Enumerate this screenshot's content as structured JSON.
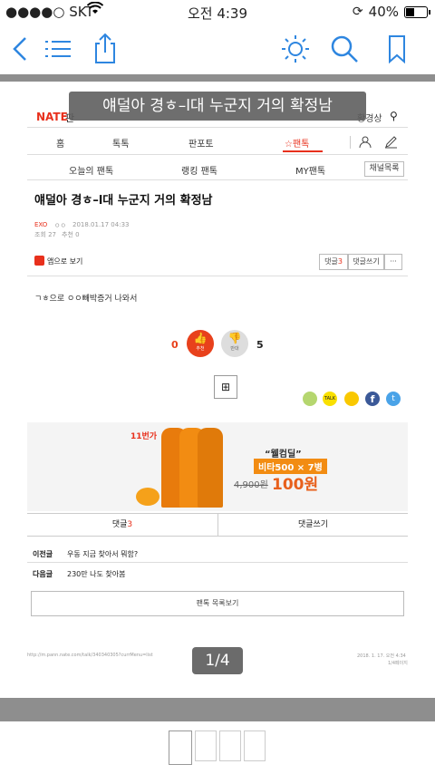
{
  "status_bar": {
    "carrier": "●●●●○ SKT",
    "time": "오전 4:39",
    "battery": "40%"
  },
  "toolbar": {
    "icons": [
      "back-icon",
      "list-icon",
      "share-icon",
      "brightness-icon",
      "search-icon",
      "bookmark-icon"
    ]
  },
  "overlay_title": "얘덜아 경ㅎ–l대 누군지 거의 확정남",
  "site": {
    "logo": "NATE",
    "sub": "판",
    "user": "황경상"
  },
  "nav": {
    "main": [
      "홈",
      "톡톡",
      "판포토",
      "☆팬톡"
    ],
    "sub": [
      "오늘의 팬톡",
      "랭킹 팬톡",
      "MY팬톡"
    ],
    "channel_btn": "채널목록"
  },
  "article": {
    "title": "얘덜아 경ㅎ–l대 누군지 거의 확정남",
    "category": "EXO",
    "author": "ㅇㅇ",
    "date": "2018.01.17 04:33",
    "views": "조회 27",
    "recommend": "추천 0",
    "app_view": "앱으로 보기",
    "comment_btn": "댓글",
    "comment_count": "3",
    "write_btn": "댓글쓰기",
    "more_btn": "···",
    "body": "ㄱㅎ으로 ㅇㅇ빼박증거 나와서"
  },
  "votes": {
    "up": "0",
    "up_label": "추천",
    "down": "5",
    "down_label": "반대"
  },
  "ad": {
    "badge": "11번가",
    "tag": "“웰컴딜”",
    "product": "비타500 × 7병",
    "old_price": "4,900원",
    "price": "100원"
  },
  "tabs": {
    "comments": "댓글",
    "comments_count": "3",
    "write": "댓글쓰기"
  },
  "prev": {
    "label": "이전글",
    "text": "우동 지금 찾아서 뭐함?"
  },
  "next": {
    "label": "다음글",
    "text": "230만 나도 찾아봄"
  },
  "list_btn": "팬톡 목록보기",
  "footer": {
    "url": "http://m.pann.nate.com/talk/340340305?currMenu=list",
    "date": "2018. 1. 17. 오전 4:34",
    "page": "1/4페이지"
  },
  "pager": "1/4",
  "colors": {
    "accent": "#2e86e0",
    "nate_red": "#e8301c",
    "vote_red": "#e8411c"
  }
}
